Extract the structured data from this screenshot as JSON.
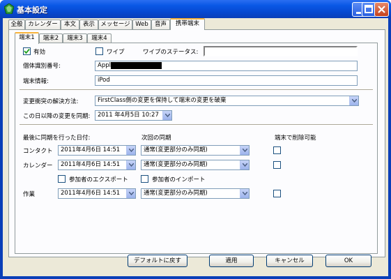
{
  "window": {
    "title": "基本設定",
    "icon": "app-icon",
    "buttons": [
      "minimize",
      "maximize",
      "close"
    ]
  },
  "main_tabs": [
    "全般",
    "カレンダー",
    "本文",
    "表示",
    "メッセージ",
    "Web",
    "音声",
    "携帯端末"
  ],
  "main_tabs_selected": "携帯端末",
  "device_tabs": [
    "端末1",
    "端末2",
    "端末3",
    "端末4"
  ],
  "device_tabs_selected": "端末1",
  "form": {
    "enabled_label": "有効",
    "enabled_checked": true,
    "wipe_label": "ワイプ",
    "wipe_checked": false,
    "wipe_status_label": "ワイプのステータス:",
    "wipe_status_value": "",
    "device_id_label": "個体識別番号:",
    "device_id_value": "Appl",
    "device_info_label": "端末情報:",
    "device_info_value": "iPod",
    "conflict_label": "変更衝突の解決方法:",
    "conflict_value": "FirstClass側の変更を保持して端末の変更を破棄",
    "sync_after_label": "この日以降の変更を同期:",
    "sync_after_value": "2011 年4月5日 10:27"
  },
  "sync": {
    "col_last": "最後に同期を行った日付:",
    "col_next": "次回の同期",
    "col_delete": "端末で削除可能",
    "rows": [
      {
        "label": "コンタクト",
        "last": "2011年4月6日 14:51",
        "next": "通常(変更部分のみ同期)",
        "deletable": false
      },
      {
        "label": "カレンダー",
        "last": "2011年4月6日 14:51",
        "next": "通常(変更部分のみ同期)",
        "deletable": false
      },
      {
        "label": "作業",
        "last": "2011年4月6日 14:51",
        "next": "通常(変更部分のみ同期)",
        "deletable": false
      }
    ],
    "export_attendees_label": "参加者のエクスポート",
    "export_attendees_checked": false,
    "import_attendees_label": "参加者のインポート",
    "import_attendees_checked": false
  },
  "buttons": {
    "default": "デフォルトに戻す",
    "apply": "適用",
    "cancel": "キャンセル",
    "ok": "OK"
  },
  "colors": {
    "titlebar": "#0a58e6",
    "selected_tab_accent": "#f8b33a",
    "dialog_bg": "#ece9d8"
  }
}
